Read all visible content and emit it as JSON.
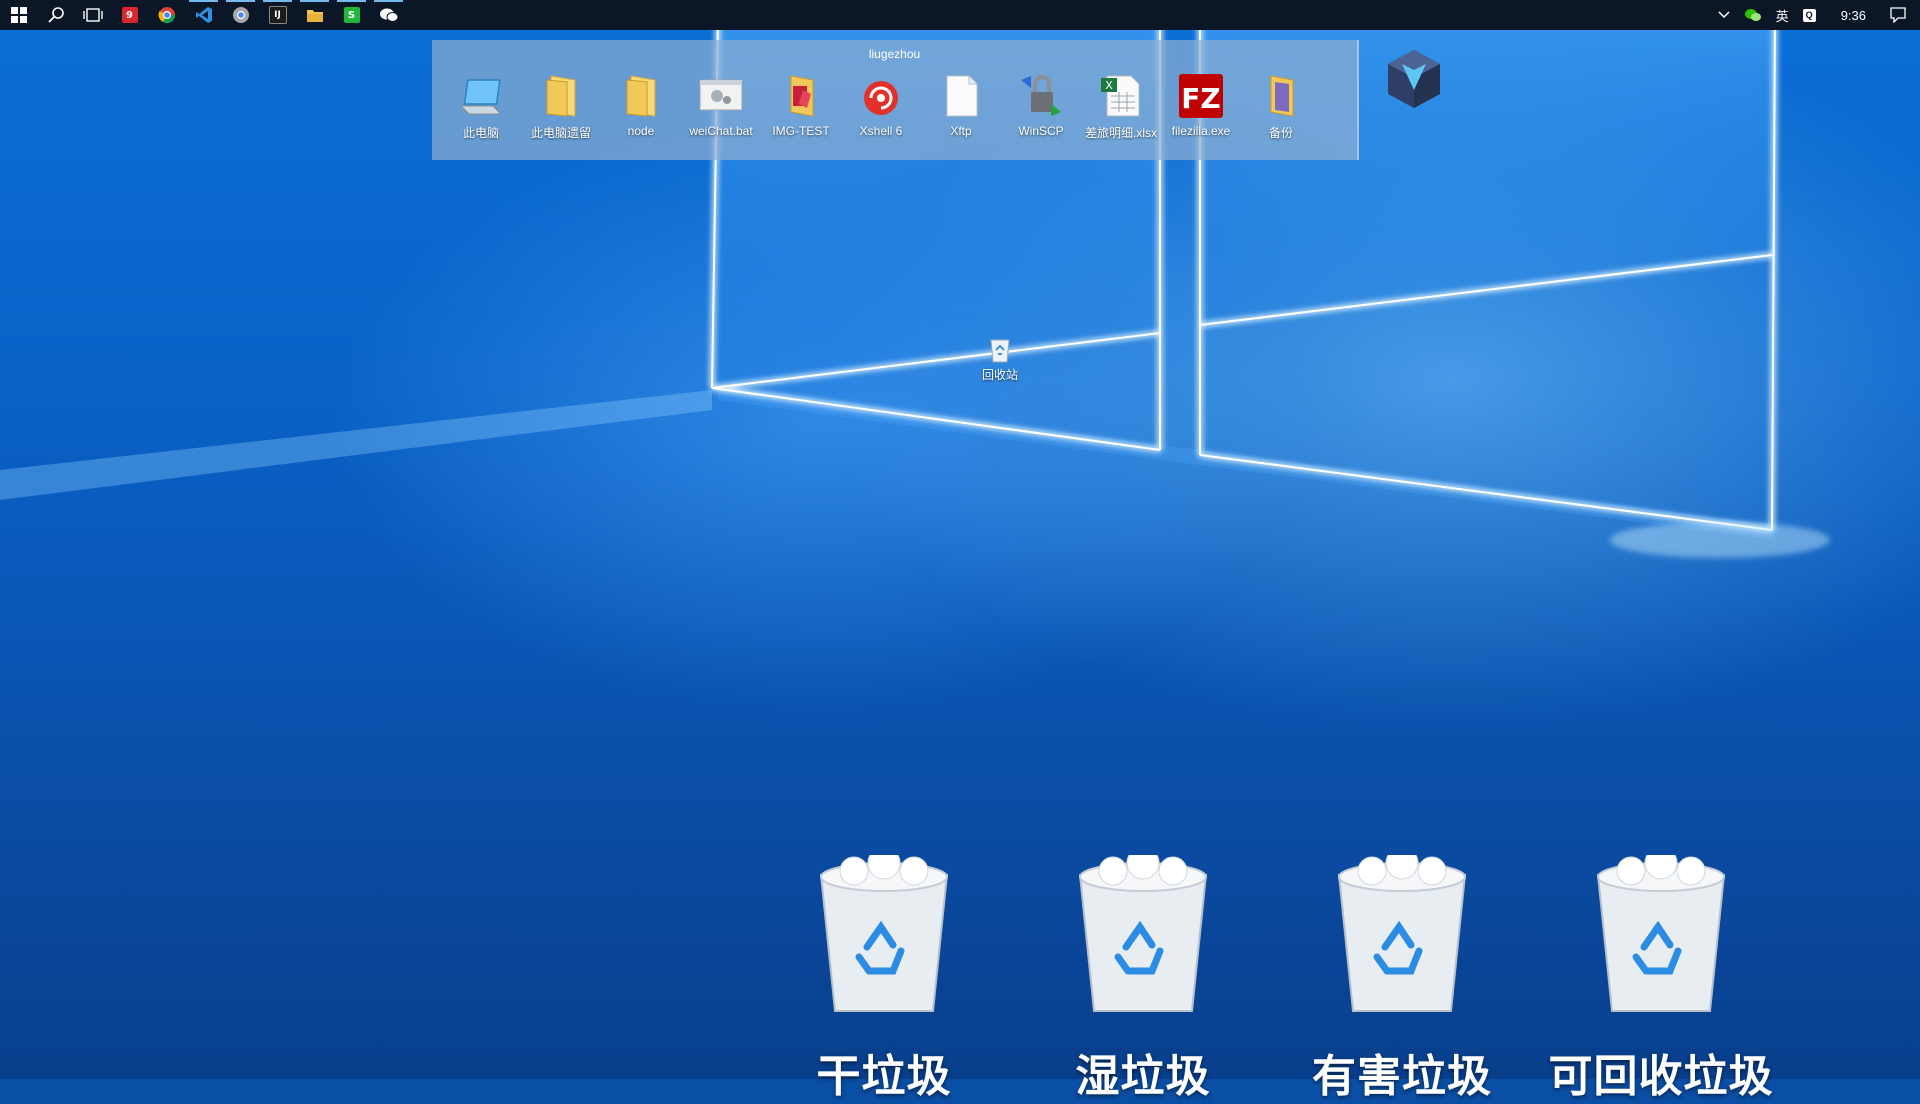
{
  "taskbar": {
    "apps": [
      {
        "icon": "windows-start-icon"
      },
      {
        "icon": "search-icon"
      },
      {
        "icon": "task-view-icon"
      },
      {
        "icon": "app-red-icon"
      },
      {
        "icon": "chrome-icon"
      },
      {
        "icon": "vscode-icon"
      },
      {
        "icon": "chrome-alt-icon"
      },
      {
        "icon": "intellij-icon"
      },
      {
        "icon": "file-explorer-icon"
      },
      {
        "icon": "green-app-icon"
      },
      {
        "icon": "wechat-icon"
      }
    ],
    "tray": {
      "ime": "英",
      "time": "9:36"
    }
  },
  "fence": {
    "title": "liugezhou",
    "items": [
      {
        "label": "此电脑",
        "icon": "computer-icon"
      },
      {
        "label": "此电脑遗留",
        "icon": "folder-icon"
      },
      {
        "label": "node",
        "icon": "folder-icon"
      },
      {
        "label": "weiChat.bat",
        "icon": "batch-file-icon"
      },
      {
        "label": "IMG-TEST",
        "icon": "folder-pdf-icon"
      },
      {
        "label": "Xshell 6",
        "icon": "xshell-icon"
      },
      {
        "label": "Xftp",
        "icon": "blank-file-icon"
      },
      {
        "label": "WinSCP",
        "icon": "winscp-icon"
      },
      {
        "label": "差旅明细.xlsx",
        "icon": "excel-file-icon"
      },
      {
        "label": "filezilla.exe",
        "icon": "filezilla-icon"
      },
      {
        "label": "备份",
        "icon": "folder-backup-icon"
      }
    ]
  },
  "desktop": {
    "recycle_bin_label": "回收站"
  },
  "bins": [
    {
      "label": "干垃圾"
    },
    {
      "label": "湿垃圾"
    },
    {
      "label": "有害垃圾"
    },
    {
      "label": "可回收垃圾"
    }
  ],
  "colors": {
    "taskbar": "#0b1726",
    "accent": "#76b9ed",
    "wallpaper": "#0a62c8"
  }
}
